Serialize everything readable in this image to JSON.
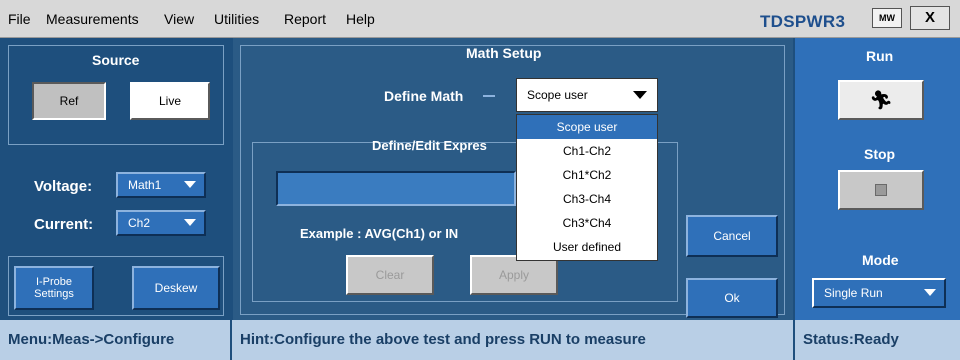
{
  "menu": {
    "items": [
      "File",
      "Measurements",
      "View",
      "Utilities",
      "Report",
      "Help"
    ],
    "app_title": "TDSPWR3",
    "app_icon_text": "MW",
    "close_label": "X"
  },
  "source": {
    "title": "Source",
    "ref_label": "Ref",
    "live_label": "Live",
    "voltage_label": "Voltage:",
    "voltage_value": "Math1",
    "current_label": "Current:",
    "current_value": "Ch2",
    "iprobe_label_1": "I-Probe",
    "iprobe_label_2": "Settings",
    "deskew_label": "Deskew"
  },
  "math_setup": {
    "title": "Math Setup",
    "define_math_label": "Define Math",
    "define_math_value": "Scope user",
    "dropdown_options": [
      "Scope user",
      "Ch1-Ch2",
      "Ch1*Ch2",
      "Ch3-Ch4",
      "Ch3*Ch4",
      "User defined"
    ],
    "selected_option": "Scope user",
    "expression_title": "Define/Edit Expres",
    "expression_value": "",
    "example_text": "Example : AVG(Ch1)  or  IN",
    "clear_label": "Clear",
    "apply_label": "Apply",
    "cancel_label": "Cancel",
    "ok_label": "Ok"
  },
  "right_panel": {
    "run_title": "Run",
    "run_icon": "running-figure-icon",
    "stop_title": "Stop",
    "stop_icon": "stop-square-icon",
    "mode_title": "Mode",
    "mode_value": "Single Run"
  },
  "status": {
    "menu_path": "Menu:Meas->Configure",
    "hint": "Hint:Configure the above test and press RUN to measure",
    "status": "Status:Ready"
  },
  "colors": {
    "background": "#1e4f7d",
    "accent_blue": "#2f70b9",
    "title_blue": "#1e4f8d",
    "statusbar": "#b9cfe6"
  }
}
